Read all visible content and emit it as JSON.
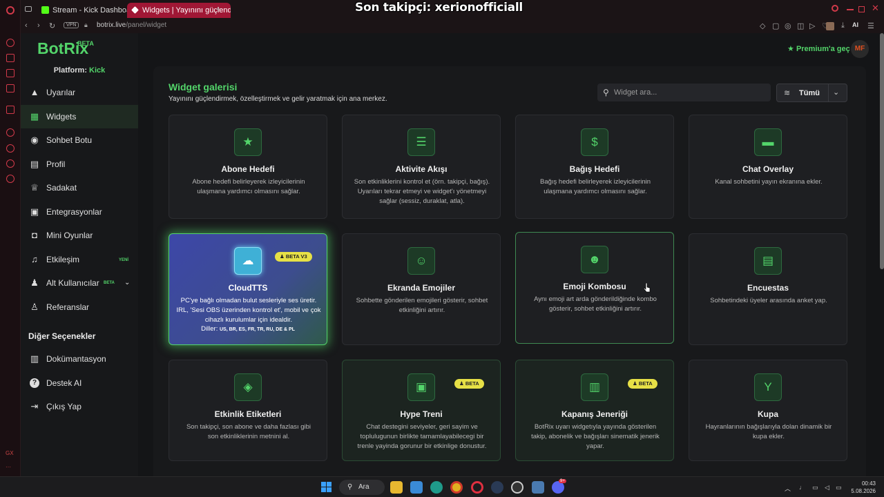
{
  "browser": {
    "tabs": [
      {
        "label": "Stream - Kick Dashboard"
      },
      {
        "label": "Widgets | Yayınını güçlend"
      }
    ],
    "url_host": "botrix.live",
    "url_path": "/panel/widget",
    "vpn": "VPN",
    "ai_label": "AI"
  },
  "overlay_text": "Son takipçi: xerionofficiall",
  "sidebar": {
    "brand": "BotRix",
    "brand_badge": "BETA",
    "platform_label": "Platform:",
    "platform_value": "Kick",
    "items": [
      {
        "label": "Uyarılar",
        "icon": "warning-icon"
      },
      {
        "label": "Widgets",
        "icon": "widgets-grid-icon"
      },
      {
        "label": "Sohbet Botu",
        "icon": "robot-icon"
      },
      {
        "label": "Profil",
        "icon": "id-card-icon"
      },
      {
        "label": "Sadakat",
        "icon": "trophy-icon"
      },
      {
        "label": "Entegrasyonlar",
        "icon": "plug-icon"
      },
      {
        "label": "Mini Oyunlar",
        "icon": "gamepad-icon"
      },
      {
        "label": "Etkileşim",
        "icon": "music-icon",
        "badge": "YENİ"
      },
      {
        "label": "Alt Kullanıcılar",
        "icon": "users-icon",
        "badge": "BETA"
      },
      {
        "label": "Referanslar",
        "icon": "user-plus-icon"
      }
    ],
    "other_options_title": "Diğer Seçenekler",
    "other_items": [
      {
        "label": "Dokümantasyon",
        "icon": "book-icon"
      },
      {
        "label": "Destek AI",
        "icon": "question-icon"
      },
      {
        "label": "Çıkış Yap",
        "icon": "logout-icon"
      }
    ]
  },
  "header": {
    "premium_label": "Premium'a geç",
    "avatar_initials": "MF"
  },
  "gallery": {
    "title": "Widget galerisi",
    "subtitle": "Yayınını güçlendirmek, özelleştirmek ve gelir yaratmak için ana merkez.",
    "search_placeholder": "Widget ara...",
    "filter_label": "Tümü"
  },
  "widgets": [
    {
      "title": "Abone Hedefi",
      "desc": "Abone hedefi belirleyerek izleyicilerinin ulaşmana yardımcı olmasını sağlar.",
      "icon": "star-icon"
    },
    {
      "title": "Aktivite Akışı",
      "desc": "Son etkinliklerini kontrol et (örn. takipçi, bağış). Uyarıları tekrar etmeyi ve widget'ı yönetmeyi sağlar (sessiz, duraklat, atla).",
      "icon": "list-icon"
    },
    {
      "title": "Bağış Hedefi",
      "desc": "Bağış hedefi belirleyerek izleyicilerinin ulaşmana yardımcı olmasını sağlar.",
      "icon": "dollar-icon"
    },
    {
      "title": "Chat Overlay",
      "desc": "Kanal sohbetini yayın ekranına ekler.",
      "icon": "chat-bubble-icon"
    },
    {
      "title": "CloudTTS",
      "desc": "PC'ye bağlı olmadan bulut sesleriyle ses üretir. IRL, 'Sesi OBS üzerinden kontrol et', mobil ve çok cihazlı kurulumlar için idealdir.",
      "languages_label": "Diller:",
      "languages": "US, BR, ES, FR, TR, RU, DE & PL",
      "icon": "cloud-icon",
      "badge": "BETA V3"
    },
    {
      "title": "Ekranda Emojiler",
      "desc": "Sohbette gönderilen emojileri gösterir, sohbet etkinliğini artırır.",
      "icon": "emoji-icon"
    },
    {
      "title": "Emoji Kombosu",
      "desc": "Aynı emoji art arda gönderildiğinde kombo gösterir, sohbet etkinliğini artırır.",
      "icon": "combo-emoji-icon"
    },
    {
      "title": "Encuestas",
      "desc": "Sohbetindeki üyeler arasında anket yap.",
      "icon": "poll-icon"
    },
    {
      "title": "Etkinlik Etiketleri",
      "desc": "Son takipçi, son abone ve daha fazlası gibi son etkinliklerinin metnini al.",
      "icon": "tags-icon"
    },
    {
      "title": "Hype Treni",
      "desc": "Chat destegini seviyeler, geri sayim ve toplulugunun birlikte tamamlayabilecegi bir trenle yayinda gorunur bir etkinlige donustur.",
      "icon": "train-icon",
      "badge": "BETA"
    },
    {
      "title": "Kapanış Jeneriği",
      "desc": "BotRix uyarı widgetıyla yayında gösterilen takip, abonelik ve bağışları sinematik jenerik yapar.",
      "icon": "film-icon",
      "badge": "BETA"
    },
    {
      "title": "Kupa",
      "desc": "Hayranlarının bağışlarıyla dolan dinamik bir kupa ekler.",
      "icon": "cocktail-icon"
    }
  ],
  "taskbar": {
    "search_label": "Ara",
    "time": "00:43",
    "date": "5.08.2026",
    "discord_badge": "9+"
  }
}
